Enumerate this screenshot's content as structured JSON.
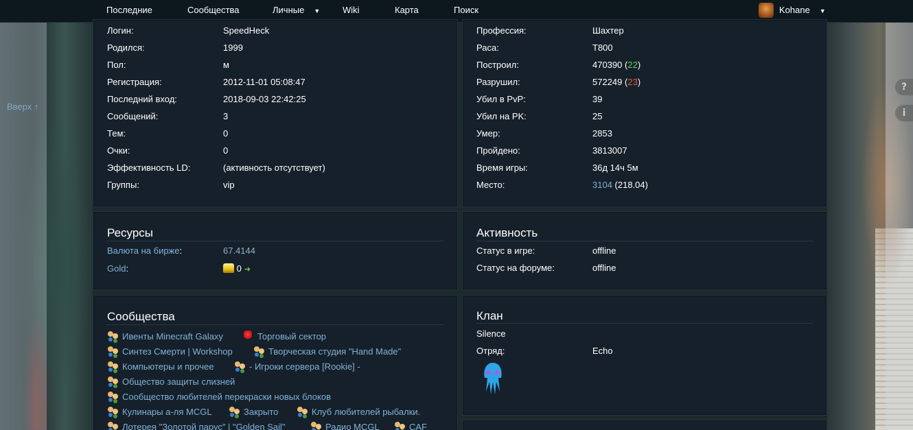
{
  "nav": {
    "items": [
      "Последние",
      "Сообщества",
      "Личные",
      "Wiki",
      "Карта",
      "Поиск"
    ],
    "user": "Kohane"
  },
  "up_link": "Вверх ↑",
  "side_buttons": [
    "?",
    "i"
  ],
  "profile": {
    "login_label": "Логин:",
    "login": "SpeedHeck",
    "born_label": "Родился:",
    "born": "1999",
    "sex_label": "Пол:",
    "sex": "м",
    "reg_label": "Регистрация:",
    "reg": "2012-11-01 05:08:47",
    "last_label": "Последний вход:",
    "last": "2018-09-03 22:42:25",
    "msgs_label": "Сообщений:",
    "msgs": "3",
    "topics_label": "Тем:",
    "topics": "0",
    "points_label": "Очки:",
    "points": "0",
    "eff_label": "Эффективность LD:",
    "eff": "(активность отсутствует)",
    "groups_label": "Группы:",
    "groups": "vip"
  },
  "stats": {
    "prof_label": "Профессия:",
    "prof": "Шахтер",
    "race_label": "Раса:",
    "race": "T800",
    "built_label": "Построил:",
    "built": "470390",
    "built_delta": "22",
    "destroyed_label": "Разрушил:",
    "destroyed": "572249",
    "destroyed_delta": "23",
    "pvp_label": "Убил в PvP:",
    "pvp": "39",
    "pk_label": "Убил на PK:",
    "pk": "25",
    "died_label": "Умер:",
    "died": "2853",
    "walked_label": "Пройдено:",
    "walked": "3813007",
    "time_label": "Время игры:",
    "time": "36д 14ч 5м",
    "place_label": "Место:",
    "place": "3104",
    "place_score": "(218.04)"
  },
  "resources": {
    "title": "Ресурсы",
    "exchange_label": "Валюта на бирже",
    "exchange": "67.4144",
    "gold_label": "Gold",
    "gold": "0"
  },
  "activity": {
    "title": "Активность",
    "game_label": "Статус в игре:",
    "game": "offline",
    "forum_label": "Статус на форуме:",
    "forum": "offline"
  },
  "communities": {
    "title": "Сообщества",
    "items": [
      "Ивенты Minecraft Galaxy",
      "Торговый сектор",
      "Синтез Смерти | Workshop",
      "Творческая студия \"Hand Made\"",
      "Компьютеры и прочее",
      "- Игроки сервера [Rookie] -",
      "Общество защиты слизней",
      "Сообщество любителей перекраски новых блоков",
      "Кулинары а-ля MCGL",
      "Закрыто",
      "Клуб любителей рыбалки.",
      "Лотерея \"Золотой парус\" | \"Golden Sail\"",
      "Радио MCGL",
      "CAF"
    ]
  },
  "clan": {
    "title": "Клан",
    "name": "Silence",
    "squad_label": "Отряд:",
    "squad": "Echo"
  },
  "colors": {
    "panel_bg": "#16202a",
    "link": "#7fb2d8",
    "green": "#5fd05a",
    "red": "#e85a4a",
    "offline": "#ff6a50"
  }
}
